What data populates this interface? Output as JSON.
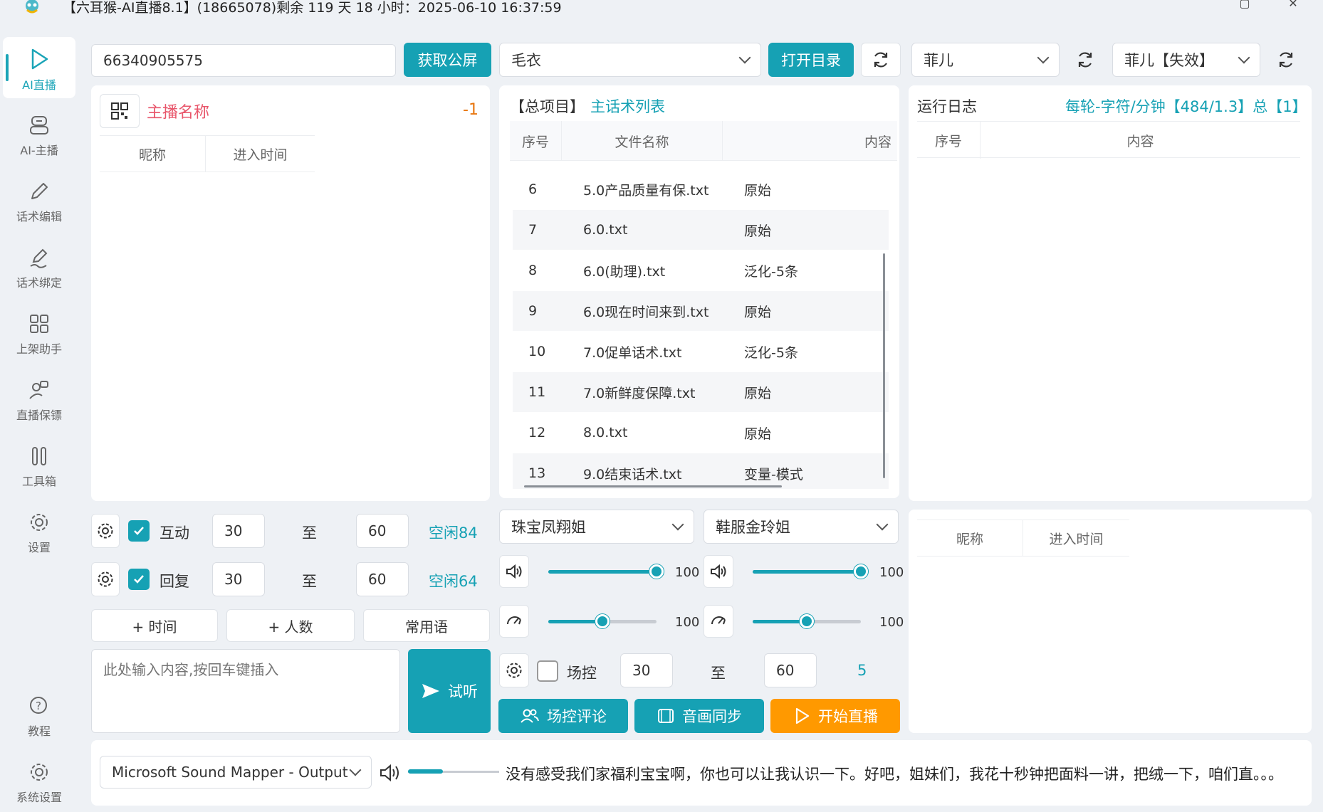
{
  "title": "【六耳猴-AI直播8.1】(18665078)剩余 119 天 18 小时：2025-06-10 16:37:59",
  "sidebar": {
    "items": [
      {
        "label": "AI直播",
        "icon": "play-icon"
      },
      {
        "label": "AI-主播",
        "icon": "robot-icon"
      },
      {
        "label": "话术编辑",
        "icon": "pencil-icon"
      },
      {
        "label": "话术绑定",
        "icon": "pen-sign-icon"
      },
      {
        "label": "上架助手",
        "icon": "grid-icon"
      },
      {
        "label": "直播保镖",
        "icon": "bodyguard-icon"
      },
      {
        "label": "工具箱",
        "icon": "tools-icon"
      },
      {
        "label": "设置",
        "icon": "gear-icon"
      },
      {
        "label": "教程",
        "icon": "help-icon"
      },
      {
        "label": "系统设置",
        "icon": "system-gear-icon"
      }
    ]
  },
  "top": {
    "room_id": "66340905575",
    "get_screen_btn": "获取公屏",
    "category": "毛衣",
    "open_dir_btn": "打开目录",
    "voice1": "菲儿",
    "voice2": "菲儿【失效】"
  },
  "anchor": {
    "title": "主播名称",
    "count": "-1",
    "col_nick": "昵称",
    "col_time": "进入时间"
  },
  "scripts": {
    "header_prefix": "【总项目】",
    "header_title": "主话术列表",
    "col_index": "序号",
    "col_file": "文件名称",
    "col_content": "内容",
    "rows": [
      {
        "index": "6",
        "file": "5.0产品质量有保.txt",
        "content": "原始"
      },
      {
        "index": "7",
        "file": "6.0.txt",
        "content": "原始"
      },
      {
        "index": "8",
        "file": "6.0(助理).txt",
        "content": "泛化-5条"
      },
      {
        "index": "9",
        "file": "6.0现在时间来到.txt",
        "content": "原始"
      },
      {
        "index": "10",
        "file": "7.0促单话术.txt",
        "content": "泛化-5条"
      },
      {
        "index": "11",
        "file": "7.0新鲜度保障.txt",
        "content": "原始"
      },
      {
        "index": "12",
        "file": "8.0.txt",
        "content": "原始"
      },
      {
        "index": "13",
        "file": "9.0结束话术.txt",
        "content": "变量-模式"
      }
    ]
  },
  "log": {
    "title": "运行日志",
    "stats": "每轮-字符/分钟【484/1.3】总【1】",
    "col_index": "序号",
    "col_content": "内容"
  },
  "controls": {
    "interact_label": "互动",
    "interact_from": "30",
    "interact_to": "60",
    "interact_idle": "空闲84",
    "reply_label": "回复",
    "reply_from": "30",
    "reply_to": "60",
    "reply_idle": "空闲64",
    "to_label": "至",
    "add_time_btn": "+ 时间",
    "add_people_btn": "+ 人数",
    "phrases_btn": "常用语",
    "insert_placeholder": "此处输入内容,按回车键插入",
    "listen_btn": "试听"
  },
  "audio": {
    "voice_a": "珠宝凤翔姐",
    "voice_b": "鞋服金玲姐",
    "vol_a": "100",
    "vol_b": "100",
    "speed_a": "100",
    "speed_b": "100",
    "vol_a_level": 1.0,
    "vol_b_level": 1.0,
    "speed_a_level": 0.5,
    "speed_b_level": 0.5,
    "field_label": "场控",
    "field_from": "30",
    "field_to": "60",
    "field_count": "5",
    "field_comment_btn": "场控评论",
    "av_sync_btn": "音画同步",
    "start_live_btn": "开始直播"
  },
  "viewers": {
    "col_nick": "昵称",
    "col_time": "进入时间"
  },
  "bottom": {
    "output_device": "Microsoft Sound Mapper - Output",
    "marquee": "没有感受我们家福利宝宝啊，你也可以让我认识一下。好吧，姐妹们，我花十秒钟把面料一讲，把绒一下，咱们直。。。",
    "progress_level": 0.38
  },
  "colors": {
    "accent": "#16a1b4",
    "orange": "#ff9900",
    "anchor_red": "#e8566b"
  }
}
